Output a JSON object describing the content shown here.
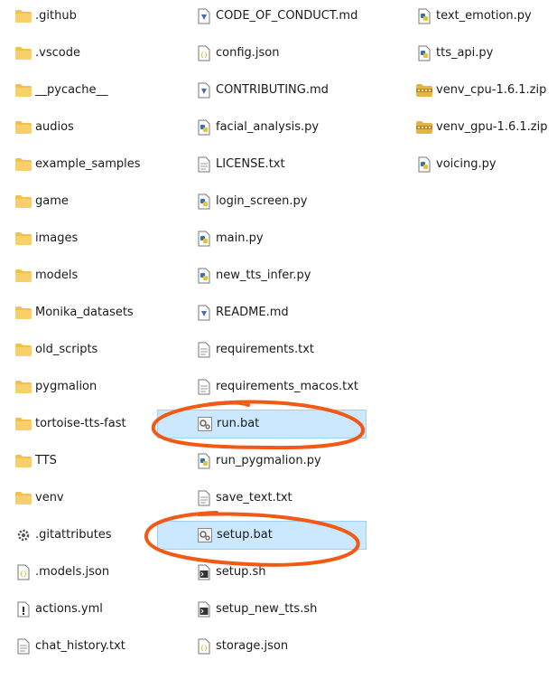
{
  "columns": [
    [
      {
        "name": "folder-github",
        "label": ".github",
        "icon": "folder-icon"
      },
      {
        "name": "folder-vscode",
        "label": ".vscode",
        "icon": "folder-icon"
      },
      {
        "name": "folder-pycache",
        "label": "__pycache__",
        "icon": "folder-icon"
      },
      {
        "name": "folder-audios",
        "label": "audios",
        "icon": "folder-icon"
      },
      {
        "name": "folder-example-samples",
        "label": "example_samples",
        "icon": "folder-icon"
      },
      {
        "name": "folder-game",
        "label": "game",
        "icon": "folder-icon"
      },
      {
        "name": "folder-images",
        "label": "images",
        "icon": "folder-icon"
      },
      {
        "name": "folder-models",
        "label": "models",
        "icon": "folder-icon"
      },
      {
        "name": "folder-monika-datasets",
        "label": "Monika_datasets",
        "icon": "folder-icon"
      },
      {
        "name": "folder-old-scripts",
        "label": "old_scripts",
        "icon": "folder-icon"
      },
      {
        "name": "folder-pygmalion",
        "label": "pygmalion",
        "icon": "folder-icon"
      },
      {
        "name": "folder-tortoise-tts-fast",
        "label": "tortoise-tts-fast",
        "icon": "folder-icon"
      },
      {
        "name": "folder-tts",
        "label": "TTS",
        "icon": "folder-icon"
      },
      {
        "name": "folder-venv",
        "label": "venv",
        "icon": "folder-icon"
      },
      {
        "name": "file-gitattributes",
        "label": ".gitattributes",
        "icon": "gear-file-icon"
      },
      {
        "name": "file-models-json",
        "label": ".models.json",
        "icon": "json-file-icon"
      },
      {
        "name": "file-actions-yml",
        "label": "actions.yml",
        "icon": "warning-file-icon"
      },
      {
        "name": "file-chat-history",
        "label": "chat_history.txt",
        "icon": "text-file-icon"
      }
    ],
    [
      {
        "name": "file-code-of-conduct",
        "label": "CODE_OF_CONDUCT.md",
        "icon": "markdown-file-icon"
      },
      {
        "name": "file-config-json",
        "label": "config.json",
        "icon": "json-file-icon"
      },
      {
        "name": "file-contributing",
        "label": "CONTRIBUTING.md",
        "icon": "markdown-file-icon"
      },
      {
        "name": "file-facial-analysis",
        "label": "facial_analysis.py",
        "icon": "python-file-icon"
      },
      {
        "name": "file-license",
        "label": "LICENSE.txt",
        "icon": "text-file-icon"
      },
      {
        "name": "file-login-screen",
        "label": "login_screen.py",
        "icon": "python-file-icon"
      },
      {
        "name": "file-main-py",
        "label": "main.py",
        "icon": "python-file-icon"
      },
      {
        "name": "file-new-tts-infer",
        "label": "new_tts_infer.py",
        "icon": "python-file-icon"
      },
      {
        "name": "file-readme",
        "label": "README.md",
        "icon": "markdown-file-icon"
      },
      {
        "name": "file-requirements",
        "label": "requirements.txt",
        "icon": "text-file-icon"
      },
      {
        "name": "file-requirements-macos",
        "label": "requirements_macos.txt",
        "icon": "text-file-icon"
      },
      {
        "name": "file-run-bat",
        "label": "run.bat",
        "icon": "batch-file-icon",
        "selected": true
      },
      {
        "name": "file-run-pygmalion",
        "label": "run_pygmalion.py",
        "icon": "python-file-icon"
      },
      {
        "name": "file-save-text",
        "label": "save_text.txt",
        "icon": "text-file-icon"
      },
      {
        "name": "file-setup-bat",
        "label": "setup.bat",
        "icon": "batch-file-icon",
        "selected": true
      },
      {
        "name": "file-setup-sh",
        "label": "setup.sh",
        "icon": "shell-file-icon"
      },
      {
        "name": "file-setup-new-tts",
        "label": "setup_new_tts.sh",
        "icon": "shell-file-icon"
      },
      {
        "name": "file-storage-json",
        "label": "storage.json",
        "icon": "json-file-icon"
      }
    ],
    [
      {
        "name": "file-text-emotion",
        "label": "text_emotion.py",
        "icon": "python-file-icon"
      },
      {
        "name": "file-tts-api",
        "label": "tts_api.py",
        "icon": "python-file-icon"
      },
      {
        "name": "file-venv-cpu-zip",
        "label": "venv_cpu-1.6.1.zip",
        "icon": "zip-folder-icon"
      },
      {
        "name": "file-venv-gpu-zip",
        "label": "venv_gpu-1.6.1.zip",
        "icon": "zip-folder-icon"
      },
      {
        "name": "file-voicing",
        "label": "voicing.py",
        "icon": "python-file-icon"
      }
    ]
  ],
  "colors": {
    "selection_bg": "#cce8ff",
    "selection_border": "#99d1ff",
    "annotation": "#f05a14",
    "folder": "#f4c04a"
  }
}
